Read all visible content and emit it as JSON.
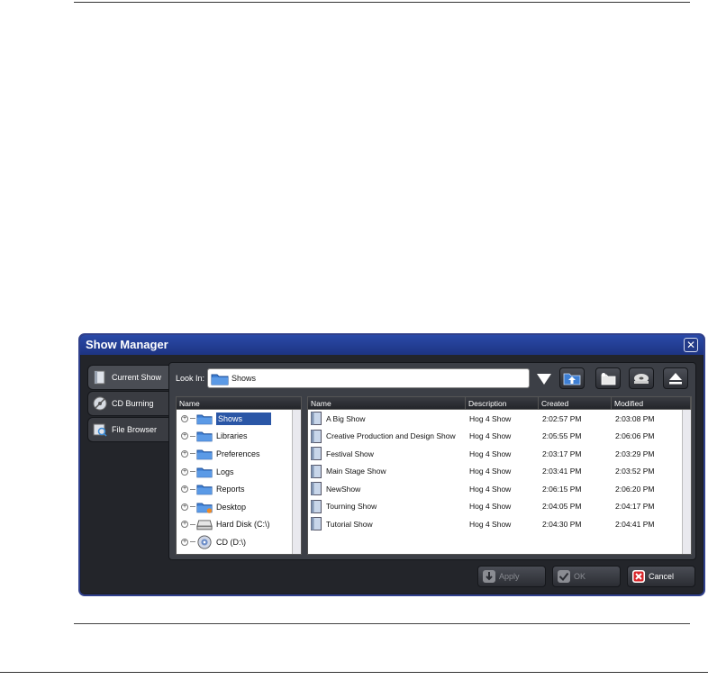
{
  "window": {
    "title": "Show Manager",
    "close_symbol": "✕"
  },
  "tabs": [
    {
      "label": "Current Show",
      "icon": "book-icon",
      "active": true
    },
    {
      "label": "CD Burning",
      "icon": "cd-burn-icon",
      "active": false
    },
    {
      "label": "File Browser",
      "icon": "file-browser-icon",
      "active": false
    }
  ],
  "look_in": {
    "label": "Look In:",
    "value": "Shows"
  },
  "toolbar": {
    "icons": [
      "dropdown-arrow-icon",
      "folder-up-icon",
      "new-folder-icon",
      "cd-drive-icon",
      "eject-icon"
    ]
  },
  "tree": {
    "header": "Name",
    "items": [
      {
        "label": "Shows",
        "icon": "folder-icon",
        "selected": true
      },
      {
        "label": "Libraries",
        "icon": "folder-icon",
        "selected": false
      },
      {
        "label": "Preferences",
        "icon": "folder-icon",
        "selected": false
      },
      {
        "label": "Logs",
        "icon": "folder-icon",
        "selected": false
      },
      {
        "label": "Reports",
        "icon": "folder-icon",
        "selected": false
      },
      {
        "label": "Desktop",
        "icon": "desktop-folder-icon",
        "selected": false
      },
      {
        "label": "Hard Disk (C:\\)",
        "icon": "hard-disk-icon",
        "selected": false
      },
      {
        "label": "CD (D:\\)",
        "icon": "cd-icon",
        "selected": false
      }
    ]
  },
  "list": {
    "columns": [
      "Name",
      "Description",
      "Created",
      "Modified"
    ],
    "rows": [
      {
        "name": "A Big Show",
        "description": "Hog 4 Show",
        "created": "2:02:57 PM",
        "modified": "2:03:08 PM"
      },
      {
        "name": "Creative Production and Design Show",
        "description": "Hog 4 Show",
        "created": "2:05:55 PM",
        "modified": "2:06:06 PM"
      },
      {
        "name": "Festival Show",
        "description": "Hog 4 Show",
        "created": "2:03:17 PM",
        "modified": "2:03:29 PM"
      },
      {
        "name": "Main Stage Show",
        "description": "Hog 4 Show",
        "created": "2:03:41 PM",
        "modified": "2:03:52 PM"
      },
      {
        "name": "NewShow",
        "description": "Hog 4 Show",
        "created": "2:06:15 PM",
        "modified": "2:06:20 PM"
      },
      {
        "name": "Tourning Show",
        "description": "Hog 4 Show",
        "created": "2:04:05 PM",
        "modified": "2:04:17 PM"
      },
      {
        "name": "Tutorial Show",
        "description": "Hog 4 Show",
        "created": "2:04:30 PM",
        "modified": "2:04:41 PM"
      }
    ]
  },
  "buttons": {
    "apply": "Apply",
    "ok": "OK",
    "cancel": "Cancel"
  },
  "colors": {
    "title_bar": "#2a4aa8",
    "selection": "#2a56a6",
    "cancel_icon": "#d9262b"
  }
}
